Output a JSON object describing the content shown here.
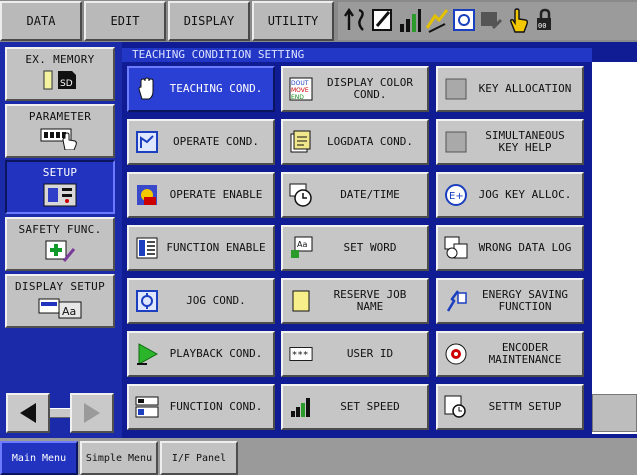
{
  "menubar": {
    "items": [
      "DATA",
      "EDIT",
      "DISPLAY",
      "UTILITY"
    ]
  },
  "window": {
    "title": "TEACHING CONDITION SETTING"
  },
  "sidebar": {
    "items": [
      {
        "label": "EX. MEMORY",
        "icon": "sd-card-icon"
      },
      {
        "label": "PARAMETER",
        "icon": "parameter-hand-icon"
      },
      {
        "label": "SETUP",
        "icon": "setup-icon"
      },
      {
        "label": "SAFETY FUNC.",
        "icon": "safety-icon"
      },
      {
        "label": "DISPLAY SETUP",
        "icon": "display-setup-icon"
      }
    ],
    "active": "SETUP"
  },
  "grid": {
    "buttons": [
      {
        "label": "TEACHING COND.",
        "icon": "hand-icon"
      },
      {
        "label": "DISPLAY COLOR\nCOND.",
        "icon": "color-icon"
      },
      {
        "label": "KEY ALLOCATION",
        "icon": "key-icon"
      },
      {
        "label": "OPERATE COND.",
        "icon": "operate-icon"
      },
      {
        "label": "LOGDATA COND.",
        "icon": "logdata-icon"
      },
      {
        "label": "SIMULTANEOUS\nKEY HELP",
        "icon": "key-help-icon"
      },
      {
        "label": "OPERATE ENABLE",
        "icon": "operate-enable-icon"
      },
      {
        "label": "DATE/TIME",
        "icon": "clock-icon"
      },
      {
        "label": "JOG KEY ALLOC.",
        "icon": "jog-key-icon"
      },
      {
        "label": "FUNCTION ENABLE",
        "icon": "function-enable-icon"
      },
      {
        "label": "SET WORD",
        "icon": "set-word-icon"
      },
      {
        "label": "WRONG DATA LOG",
        "icon": "wrong-data-icon"
      },
      {
        "label": "JOG COND.",
        "icon": "jog-icon"
      },
      {
        "label": "RESERVE JOB\nNAME",
        "icon": "reserve-job-icon"
      },
      {
        "label": "ENERGY SAVING\nFUNCTION",
        "icon": "energy-icon"
      },
      {
        "label": "PLAYBACK COND.",
        "icon": "playback-icon"
      },
      {
        "label": "USER ID",
        "icon": "user-id-icon"
      },
      {
        "label": "ENCODER\nMAINTENANCE",
        "icon": "encoder-icon"
      },
      {
        "label": "FUNCTION COND.",
        "icon": "function-icon"
      },
      {
        "label": "SET SPEED",
        "icon": "speed-icon"
      },
      {
        "label": "SETTM SETUP",
        "icon": "settm-icon"
      }
    ]
  },
  "bottombar": {
    "tabs": [
      "Main Menu",
      "Simple Menu",
      "I/F Panel"
    ]
  }
}
